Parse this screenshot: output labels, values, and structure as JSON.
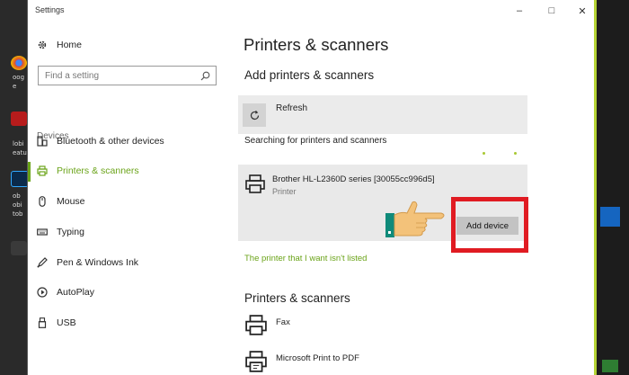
{
  "window": {
    "title": "Settings"
  },
  "window_controls": {
    "minimize": "–",
    "maximize": "□",
    "close": "✕"
  },
  "sidebar": {
    "home": "Home",
    "search_placeholder": "Find a setting",
    "section": "Devices",
    "items": [
      {
        "label": "Bluetooth & other devices",
        "icon": "bluetooth-devices-icon"
      },
      {
        "label": "Printers & scanners",
        "icon": "printer-icon",
        "selected": true
      },
      {
        "label": "Mouse",
        "icon": "mouse-icon"
      },
      {
        "label": "Typing",
        "icon": "keyboard-icon"
      },
      {
        "label": "Pen & Windows Ink",
        "icon": "pen-icon"
      },
      {
        "label": "AutoPlay",
        "icon": "autoplay-icon"
      },
      {
        "label": "USB",
        "icon": "usb-icon"
      }
    ]
  },
  "main": {
    "title": "Printers & scanners",
    "add_heading": "Add printers & scanners",
    "refresh_label": "Refresh",
    "searching_text": "Searching for printers and scanners",
    "found_device": {
      "name": "Brother HL-L2360D series [30055cc996d5]",
      "type": "Printer",
      "action": "Add device"
    },
    "not_listed_link": "The printer that I want isn't listed",
    "list_heading": "Printers & scanners",
    "printers": [
      "Fax",
      "Microsoft Print to PDF"
    ]
  },
  "desktop": {
    "left_labels": [
      "oog",
      "e",
      "lobi",
      "eatu",
      "ob",
      "obi",
      "tob"
    ]
  },
  "colors": {
    "accent": "#6aa318",
    "highlight": "#e01b22",
    "window_border": "#b5d335"
  }
}
